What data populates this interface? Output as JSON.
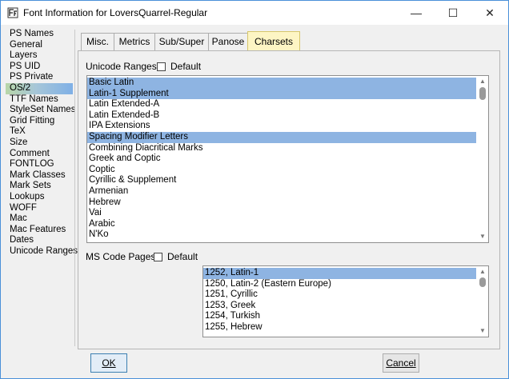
{
  "window": {
    "title": "Font Information for LoversQuarrel-Regular",
    "minimize_glyph": "—",
    "maximize_glyph": "☐",
    "close_glyph": "✕"
  },
  "sidebar": {
    "items": [
      {
        "label": "PS Names"
      },
      {
        "label": "General"
      },
      {
        "label": "Layers"
      },
      {
        "label": "PS UID"
      },
      {
        "label": "PS Private"
      },
      {
        "label": "OS/2",
        "selected": true
      },
      {
        "label": "TTF Names"
      },
      {
        "label": "StyleSet Names"
      },
      {
        "label": "Grid Fitting"
      },
      {
        "label": "TeX"
      },
      {
        "label": "Size"
      },
      {
        "label": "Comment"
      },
      {
        "label": "FONTLOG"
      },
      {
        "label": "Mark Classes"
      },
      {
        "label": "Mark Sets"
      },
      {
        "label": "Lookups"
      },
      {
        "label": "WOFF"
      },
      {
        "label": "Mac"
      },
      {
        "label": "Mac Features"
      },
      {
        "label": "Dates"
      },
      {
        "label": "Unicode Ranges"
      }
    ]
  },
  "tabs": [
    {
      "label": "Misc."
    },
    {
      "label": "Metrics"
    },
    {
      "label": "Sub/Super"
    },
    {
      "label": "Panose"
    },
    {
      "label": "Charsets",
      "active": true
    }
  ],
  "unicode_ranges": {
    "label": "Unicode Ranges:",
    "default_label": "Default",
    "default_checked": false,
    "items": [
      {
        "label": "Basic Latin",
        "selected": true
      },
      {
        "label": "Latin-1 Supplement",
        "selected": true
      },
      {
        "label": "Latin Extended-A"
      },
      {
        "label": "Latin Extended-B"
      },
      {
        "label": "IPA Extensions"
      },
      {
        "label": "Spacing Modifier Letters",
        "selected": true
      },
      {
        "label": "Combining Diacritical Marks"
      },
      {
        "label": "Greek and Coptic"
      },
      {
        "label": "Coptic"
      },
      {
        "label": "Cyrillic & Supplement"
      },
      {
        "label": "Armenian"
      },
      {
        "label": "Hebrew"
      },
      {
        "label": "Vai"
      },
      {
        "label": "Arabic"
      },
      {
        "label": "N'Ko"
      }
    ]
  },
  "code_pages": {
    "label": "MS Code Pages:",
    "default_label": "Default",
    "default_checked": false,
    "items": [
      {
        "label": "1252, Latin-1",
        "selected": true
      },
      {
        "label": "1250, Latin-2 (Eastern Europe)"
      },
      {
        "label": "1251, Cyrillic"
      },
      {
        "label": "1253, Greek"
      },
      {
        "label": "1254, Turkish"
      },
      {
        "label": "1255, Hebrew"
      }
    ]
  },
  "buttons": {
    "ok_label": "OK",
    "cancel_label": "Cancel"
  },
  "colors": {
    "selection": "#8eb4e2",
    "active_tab": "#fdf5c4",
    "window_border": "#4a90d9"
  }
}
